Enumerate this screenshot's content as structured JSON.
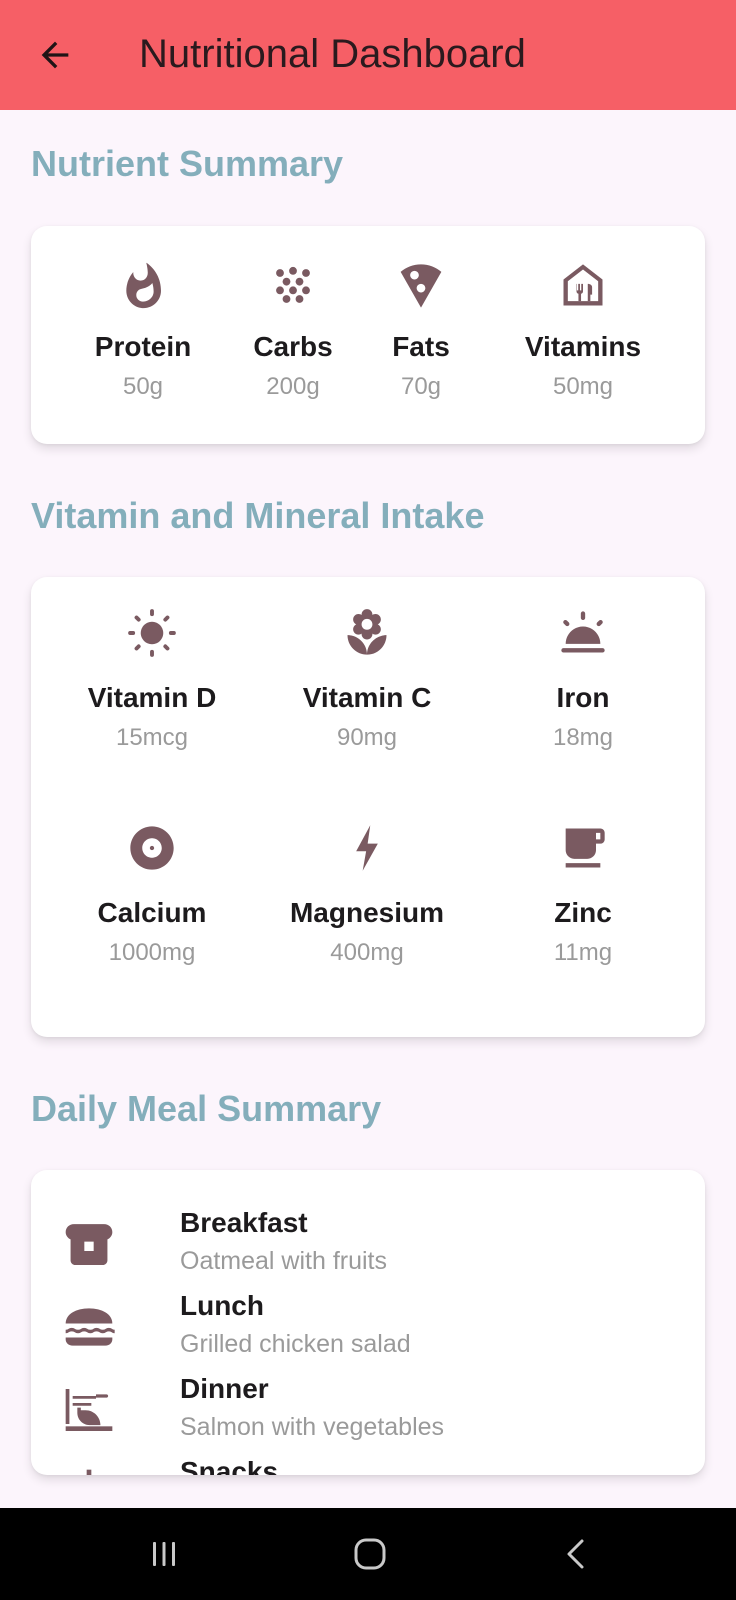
{
  "appbar": {
    "title": "Nutritional Dashboard",
    "back_icon": "arrow-back-icon",
    "color": "#f65f66"
  },
  "nutrient_section": {
    "title": "Nutrient Summary",
    "items": [
      {
        "name": "Protein",
        "value": "50g",
        "icon": "fire-icon"
      },
      {
        "name": "Carbs",
        "value": "200g",
        "icon": "grain-icon"
      },
      {
        "name": "Fats",
        "value": "70g",
        "icon": "pizza-slice-icon"
      },
      {
        "name": "Vitamins",
        "value": "50mg",
        "icon": "restaurant-house-icon"
      }
    ]
  },
  "mineral_section": {
    "title": "Vitamin and Mineral Intake",
    "items": [
      {
        "name": "Vitamin D",
        "value": "15mcg",
        "icon": "sun-icon"
      },
      {
        "name": "Vitamin C",
        "value": "90mg",
        "icon": "flower-icon"
      },
      {
        "name": "Iron",
        "value": "18mg",
        "icon": "sunrise-icon"
      },
      {
        "name": "Calcium",
        "value": "1000mg",
        "icon": "disc-icon"
      },
      {
        "name": "Magnesium",
        "value": "400mg",
        "icon": "bolt-icon"
      },
      {
        "name": "Zinc",
        "value": "11mg",
        "icon": "coffee-cup-icon"
      }
    ]
  },
  "meal_section": {
    "title": "Daily Meal Summary",
    "items": [
      {
        "title": "Breakfast",
        "subtitle": "Oatmeal with fruits",
        "icon": "bread-icon"
      },
      {
        "title": "Lunch",
        "subtitle": "Grilled chicken salad",
        "icon": "burger-icon"
      },
      {
        "title": "Dinner",
        "subtitle": "Salmon with vegetables",
        "icon": "dinner-dining-icon"
      },
      {
        "title": "Snacks",
        "subtitle": "",
        "icon": "snack-icon"
      }
    ]
  },
  "colors": {
    "icon": "#7a5a61",
    "section_title": "#84aebb",
    "background": "#fcf5fc"
  },
  "navbar": {
    "recents_icon": "recents-icon",
    "home_icon": "home-icon",
    "back_icon": "nav-back-icon"
  }
}
